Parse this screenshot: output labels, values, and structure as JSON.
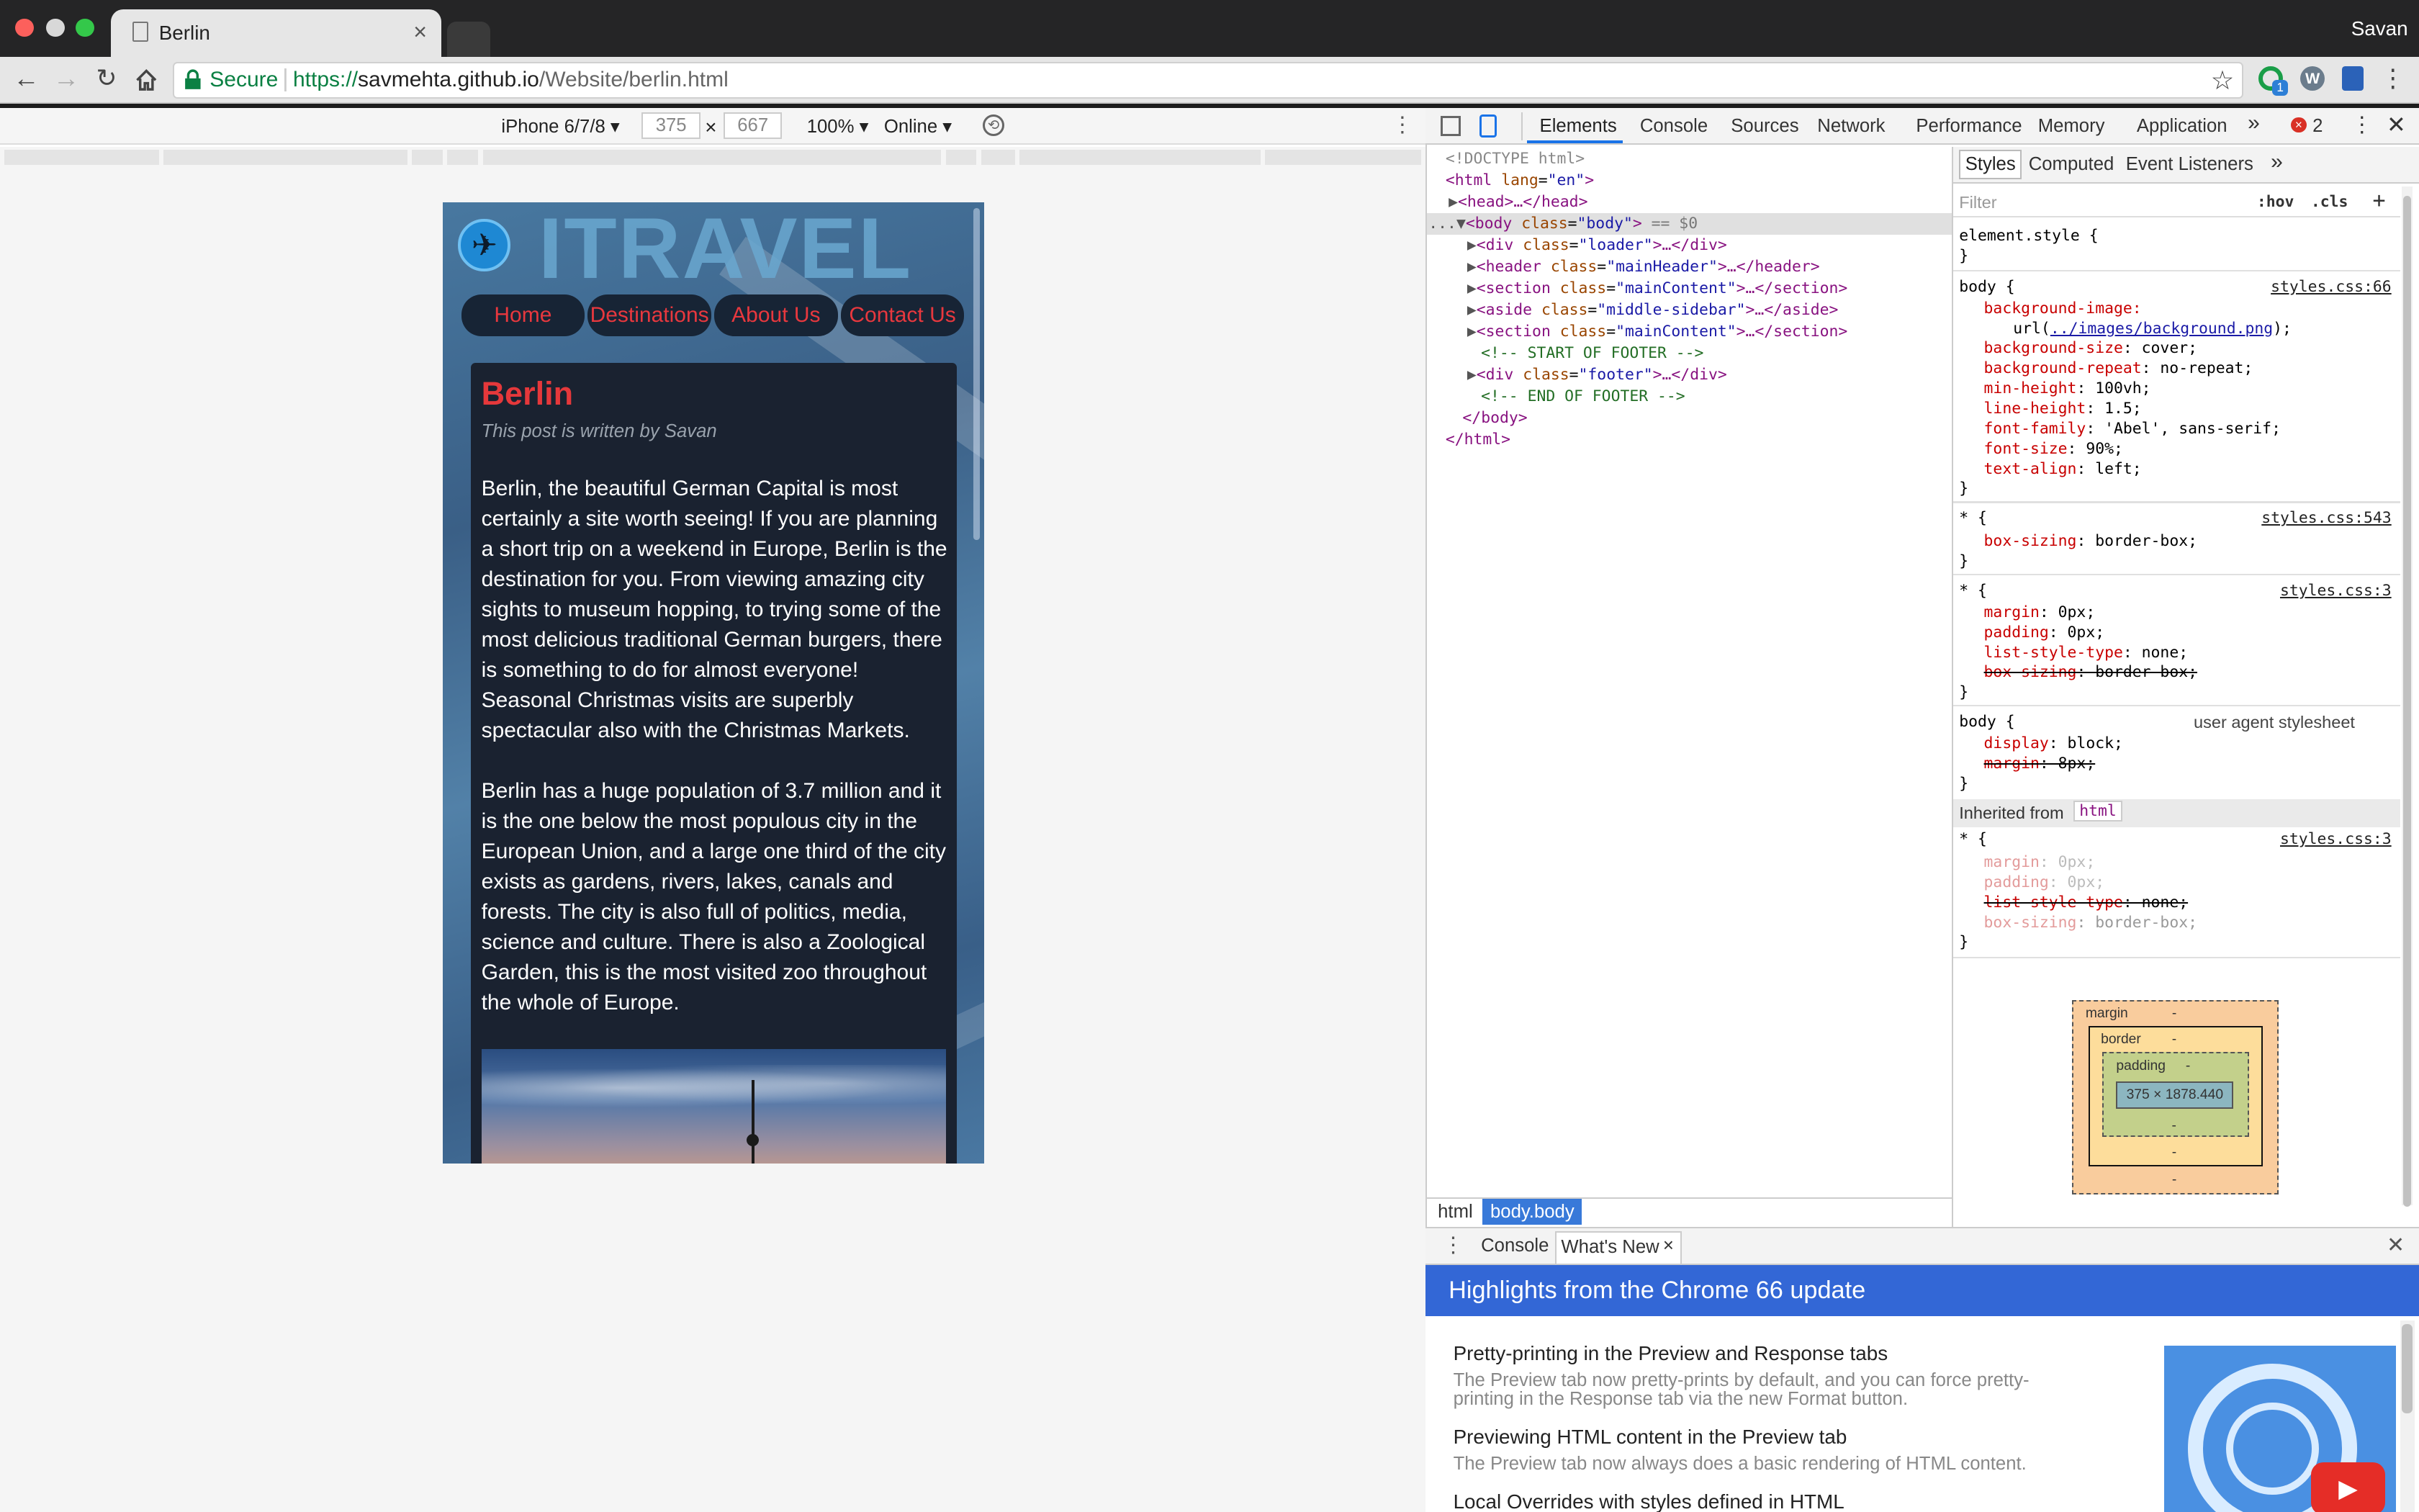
{
  "window": {
    "user": "Savan"
  },
  "tab": {
    "title": "Berlin",
    "close": "×"
  },
  "address": {
    "secure": "Secure",
    "url_scheme": "https://",
    "url_host": "savmehta.github.io",
    "url_path": "/Website/berlin.html"
  },
  "device_toolbar": {
    "device": "iPhone 6/7/8",
    "width": "375",
    "times": "×",
    "height": "667",
    "zoom": "100%",
    "network": "Online"
  },
  "page": {
    "logo": "ITRAVEL",
    "nav": [
      "Home",
      "Destinations",
      "About Us",
      "Contact Us"
    ],
    "post": {
      "title": "Berlin",
      "byline": "This post is written by Savan",
      "p1": "Berlin, the beautiful German Capital is most certainly a site worth seeing! If you are planning a short trip on a weekend in Europe, Berlin is the destination for you. From viewing amazing city sights to museum hopping, to trying some of the most delicious traditional German burgers, there is something to do for almost everyone! Seasonal Christmas visits are superbly spectacular also with the Christmas Markets.",
      "p2": "Berlin has a huge population of 3.7 million and it is the one below the most populous city in the European Union, and a large one third of the city exists as gardens, rivers, lakes, canals and forests. The city is also full of politics, media, science and culture. There is also a Zoological Garden, this is the most visited zoo throughout the whole of Europe."
    }
  },
  "devtools": {
    "tabs": [
      "Elements",
      "Console",
      "Sources",
      "Network",
      "Performance",
      "Memory",
      "Application"
    ],
    "more": "»",
    "errors": "2",
    "active_tab": "Elements",
    "dom": {
      "doctype": "<!DOCTYPE html>",
      "html_open": "<html",
      "lang_attr": "lang",
      "lang_val": "\"en\"",
      "head": "<head>…</head>",
      "body_prefix": "...",
      "body_open": "<body",
      "class_attr": "class",
      "body_class": "\"body\"",
      "body_suffix": "== $0",
      "children": [
        {
          "tag": "<div",
          "cls": "\"loader\"",
          "end": ">…</div>"
        },
        {
          "tag": "<header",
          "cls": "\"mainHeader\"",
          "end": ">…</header>"
        },
        {
          "tag": "<section",
          "cls": "\"mainContent\"",
          "end": ">…</section>"
        },
        {
          "tag": "<aside",
          "cls": "\"middle-sidebar\"",
          "end": ">…</aside>"
        },
        {
          "tag": "<section",
          "cls": "\"mainContent\"",
          "end": ">…</section>"
        }
      ],
      "comment_start": "<!-- START OF FOOTER -->",
      "footer_tag": "<div",
      "footer_cls": "\"footer\"",
      "footer_end": ">…</div>",
      "comment_end": "<!-- END OF FOOTER -->",
      "body_close": "</body>",
      "html_close": "</html>"
    },
    "breadcrumbs": [
      "html",
      "body.body"
    ],
    "styles": {
      "tabs": [
        "Styles",
        "Computed",
        "Event Listeners"
      ],
      "filter": "Filter",
      "hov": ":hov",
      "cls": ".cls",
      "element_style": "element.style {",
      "close_brace": "}",
      "rule_body": {
        "selector": "body {",
        "source": "styles.css:66",
        "bg_image": "background-image:",
        "bg_url_pre": "url(",
        "bg_url": "../images/background.png",
        "bg_url_post": ");",
        "props": [
          [
            "background-size",
            ": cover;"
          ],
          [
            "background-repeat",
            ": no-repeat;"
          ],
          [
            "min-height",
            ": 100vh;"
          ],
          [
            "line-height",
            ": 1.5;"
          ],
          [
            "font-family",
            ": 'Abel', sans-serif;"
          ],
          [
            "font-size",
            ": 90%;"
          ],
          [
            "text-align",
            ": left;"
          ]
        ]
      },
      "rule_star1": {
        "selector": "* {",
        "source": "styles.css:543",
        "prop": "box-sizing",
        "val": ": border-box;"
      },
      "rule_star2": {
        "selector": "* {",
        "source": "styles.css:3",
        "props": [
          [
            "margin",
            ": 0px;"
          ],
          [
            "padding",
            ": 0px;"
          ],
          [
            "list-style-type",
            ": none;"
          ],
          [
            "box-sizing",
            ": border-box;"
          ]
        ]
      },
      "rule_ua": {
        "selector": "body {",
        "source": "user agent stylesheet",
        "props": [
          [
            "display",
            ": block;"
          ],
          [
            "margin",
            ": 8px;"
          ]
        ]
      },
      "inherited": "Inherited from",
      "inherited_tag": "html",
      "rule_star3": {
        "selector": "* {",
        "source": "styles.css:3",
        "props": [
          [
            "margin",
            ": 0px;"
          ],
          [
            "padding",
            ": 0px;"
          ],
          [
            "list-style-type",
            ": none;"
          ],
          [
            "box-sizing",
            ": border-box;"
          ]
        ]
      },
      "boxmodel": {
        "margin": "margin",
        "border": "border",
        "padding": "padding",
        "dash": "-",
        "content": "375 × 1878.440"
      }
    },
    "drawer": {
      "tabs": [
        "Console",
        "What's New"
      ],
      "banner": "Highlights from the Chrome 66 update",
      "items": [
        {
          "title": "Pretty-printing in the Preview and Response tabs",
          "desc": "The Preview tab now pretty-prints by default, and you can force pretty-printing in the Response tab via the new Format button."
        },
        {
          "title": "Previewing HTML content in the Preview tab",
          "desc": "The Preview tab now always does a basic rendering of HTML content."
        },
        {
          "title": "Local Overrides with styles defined in HTML",
          "desc": ""
        }
      ]
    }
  }
}
